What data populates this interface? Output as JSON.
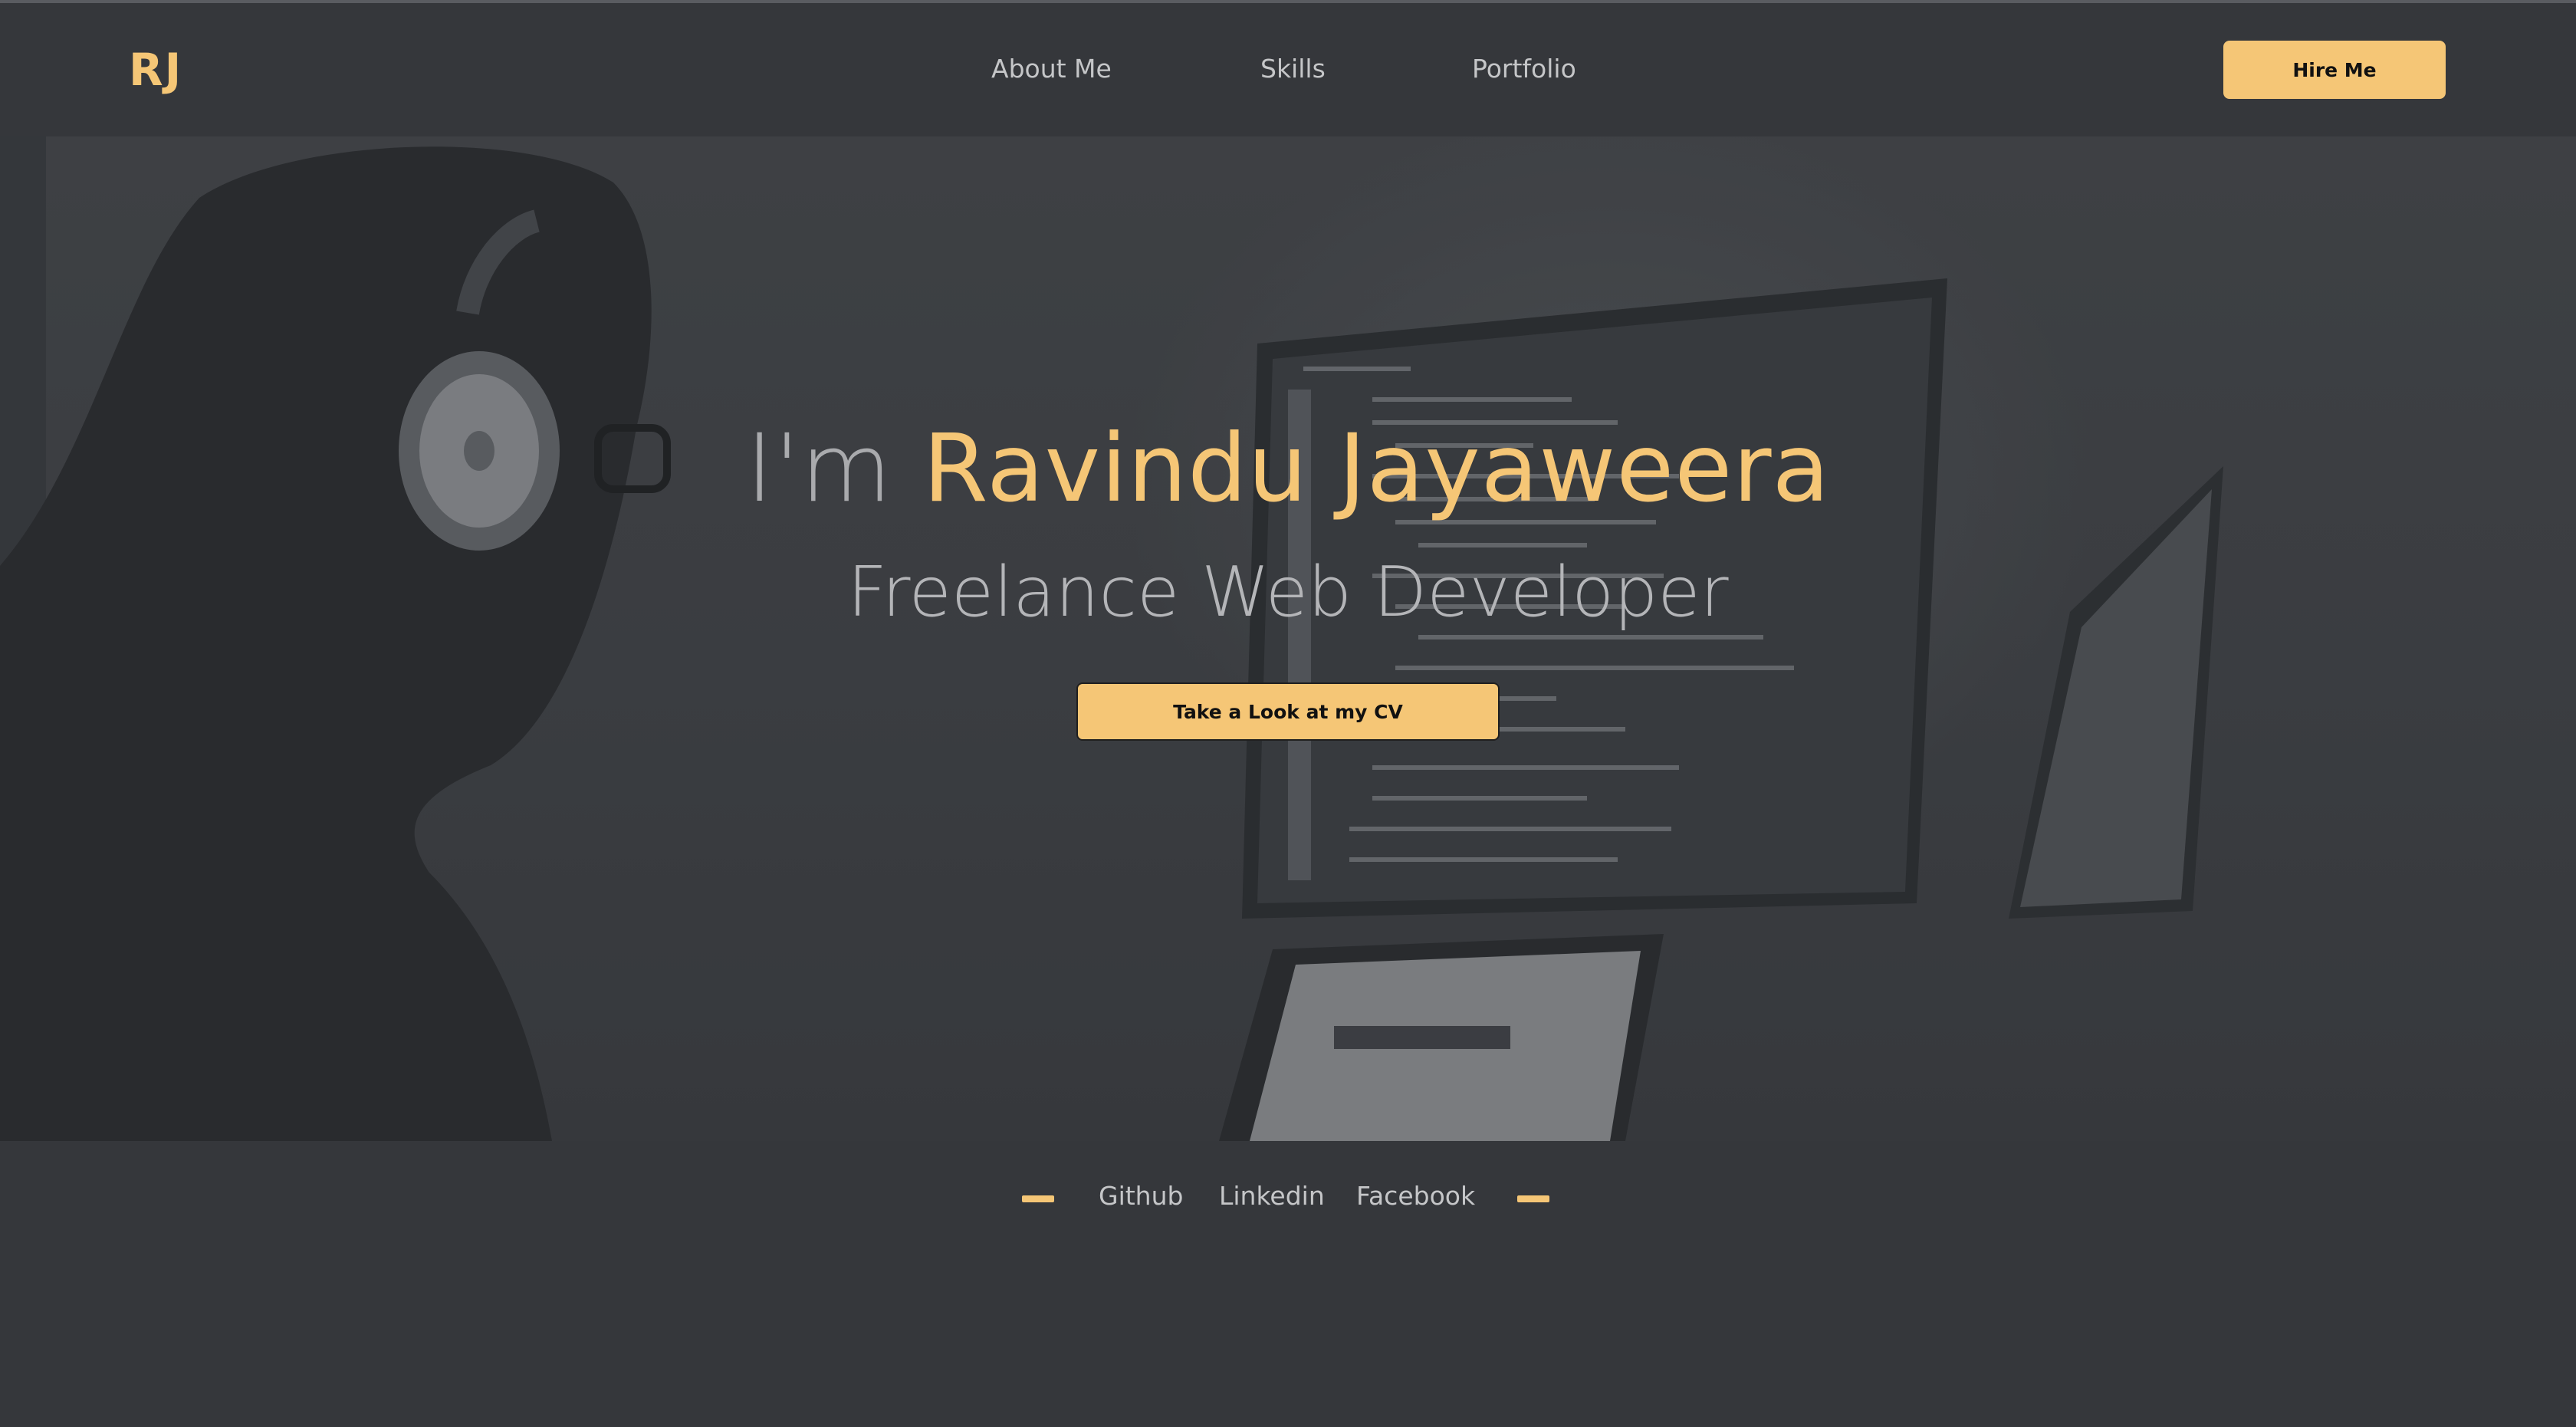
{
  "colors": {
    "accent": "#f5c676",
    "background": "#35373b",
    "nav_text": "#c5c6c8",
    "muted_text": "#a9aaad"
  },
  "nav": {
    "logo": "RJ",
    "links": [
      {
        "label": "About Me"
      },
      {
        "label": "Skills"
      },
      {
        "label": "Portfolio"
      }
    ],
    "hire_button": "Hire Me"
  },
  "hero": {
    "title_prefix": "I'm",
    "title_name": "Ravindu Jayaweera",
    "subtitle": "Freelance Web Developer",
    "cv_button": "Take a Look at my CV",
    "background_image": "developer-with-headphones-at-computer-screens"
  },
  "social": {
    "links": [
      {
        "label": "Github"
      },
      {
        "label": "Linkedin"
      },
      {
        "label": "Facebook"
      }
    ]
  }
}
